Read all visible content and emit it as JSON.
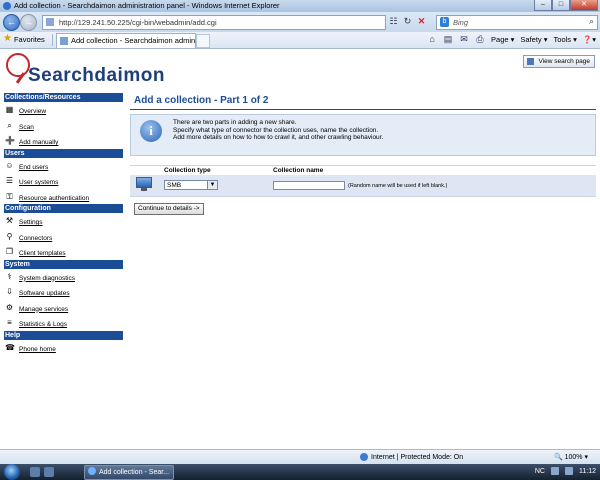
{
  "window": {
    "title": "Add collection - Searchdaimon administration panel - Windows Internet Explorer"
  },
  "browser": {
    "url": "http://129.241.50.225/cgi-bin/webadmin/add.cgi",
    "search_engine": "Bing",
    "favorites_label": "Favorites",
    "tab_title": "Add collection - Searchdaimon admin...",
    "cmd": {
      "page": "Page ▾",
      "safety": "Safety ▾",
      "tools": "Tools ▾",
      "help": "❓▾"
    }
  },
  "header": {
    "logo_text": "Searchdaimon",
    "view_search_label": "View search page"
  },
  "sidebar": {
    "sections": [
      {
        "title": "Collections/Resources",
        "items": [
          {
            "label": "Overview",
            "icon": "overview-icon"
          },
          {
            "label": "Scan",
            "icon": "scan-icon"
          },
          {
            "label": "Add manually",
            "icon": "add-icon"
          }
        ]
      },
      {
        "title": "Users",
        "items": [
          {
            "label": "End users",
            "icon": "users-icon"
          },
          {
            "label": "User systems",
            "icon": "user-systems-icon"
          },
          {
            "label": "Resource authentication",
            "icon": "auth-icon"
          }
        ]
      },
      {
        "title": "Configuration",
        "items": [
          {
            "label": "Settings",
            "icon": "settings-icon"
          },
          {
            "label": "Connectors",
            "icon": "connectors-icon"
          },
          {
            "label": "Client templates",
            "icon": "templates-icon"
          }
        ]
      },
      {
        "title": "System",
        "items": [
          {
            "label": "System diagnostics",
            "icon": "diagnostics-icon"
          },
          {
            "label": "Software updates",
            "icon": "updates-icon"
          },
          {
            "label": "Manage services",
            "icon": "services-icon"
          },
          {
            "label": "Statistics & Logs",
            "icon": "stats-icon"
          }
        ]
      },
      {
        "title": "Help",
        "items": [
          {
            "label": "Phone home",
            "icon": "phone-home-icon"
          }
        ]
      }
    ]
  },
  "main": {
    "title": "Add a collection - Part 1 of 2",
    "info_lines": [
      "There are two parts in adding a new share.",
      "Specify what type of connector the collection uses, name the collection.",
      "Add more details on how to how to crawl it, and other crawling behaviour."
    ],
    "form": {
      "col_type": "Collection type",
      "col_name": "Collection name",
      "type_value": "SMB",
      "name_value": "",
      "name_hint": "(Random name will be used if left blank.)"
    },
    "continue_label": "Continue to details ->"
  },
  "statusbar": {
    "zone": "Internet | Protected Mode: On",
    "zoom": "🔍 100% ▾"
  },
  "taskbar": {
    "task": "Add collection - Sear...",
    "lang": "NC",
    "time": "11:12"
  }
}
